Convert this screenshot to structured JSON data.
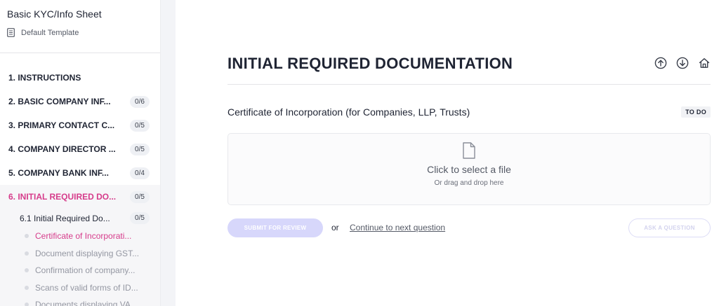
{
  "sidebar": {
    "title": "Basic KYC/Info Sheet",
    "template": "Default Template",
    "sections": [
      {
        "label": "1. INSTRUCTIONS",
        "count": ""
      },
      {
        "label": "2. BASIC COMPANY INF...",
        "count": "0/6"
      },
      {
        "label": "3. PRIMARY CONTACT C...",
        "count": "0/5"
      },
      {
        "label": "4. COMPANY DIRECTOR ...",
        "count": "0/5"
      },
      {
        "label": "5. COMPANY BANK INF...",
        "count": "0/4"
      },
      {
        "label": "6. INITIAL REQUIRED DO...",
        "count": "0/5"
      }
    ],
    "subsection": {
      "label": "6.1 Initial Required Do...",
      "count": "0/5"
    },
    "questions": [
      "Certificate of Incorporati...",
      "Document displaying GST...",
      "Confirmation of company...",
      "Scans of valid forms of ID...",
      "Documents displaying VA..."
    ]
  },
  "main": {
    "title": "INITIAL REQUIRED DOCUMENTATION",
    "question": "Certificate of Incorporation (for Companies, LLP, Trusts)",
    "status": "TO DO",
    "dropzone": {
      "main": "Click to select a file",
      "sub": "Or drag and drop here"
    },
    "actions": {
      "submit": "SUBMIT FOR REVIEW",
      "or": "or",
      "continue": "Continue to next question",
      "ask": "ASK A QUESTION"
    }
  },
  "colors": {
    "accent_pink": "#d63c8b",
    "submit_disabled": "#d7d7fb",
    "text_dark": "#1f2433"
  },
  "icons": [
    "document-icon",
    "arrow-up-circle-icon",
    "arrow-down-circle-icon",
    "home-icon",
    "file-icon"
  ]
}
